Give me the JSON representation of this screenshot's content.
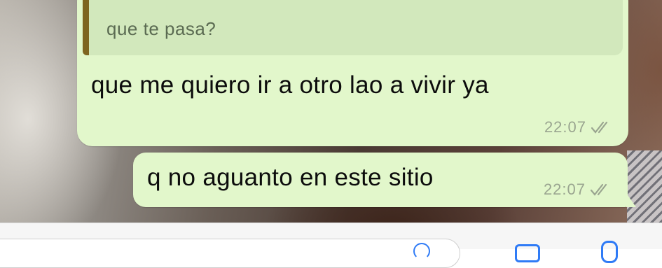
{
  "chat": {
    "messages": [
      {
        "quoted_text": "que te pasa?",
        "text": "que me quiero ir a otro lao a vivir ya",
        "time": "22:07",
        "status_icon": "double-check-icon"
      },
      {
        "text": "q no aguanto en este sitio",
        "time": "22:07",
        "status_icon": "double-check-icon"
      }
    ]
  },
  "composer": {
    "icons": [
      "sticker-icon",
      "camera-icon",
      "microphone-icon"
    ]
  },
  "colors": {
    "bubble": "#e2f7cb",
    "quote_background": "#d2e8bc",
    "quote_bar": "#7e6520",
    "meta_text": "#9aa590",
    "accent": "#2f7bf6"
  }
}
